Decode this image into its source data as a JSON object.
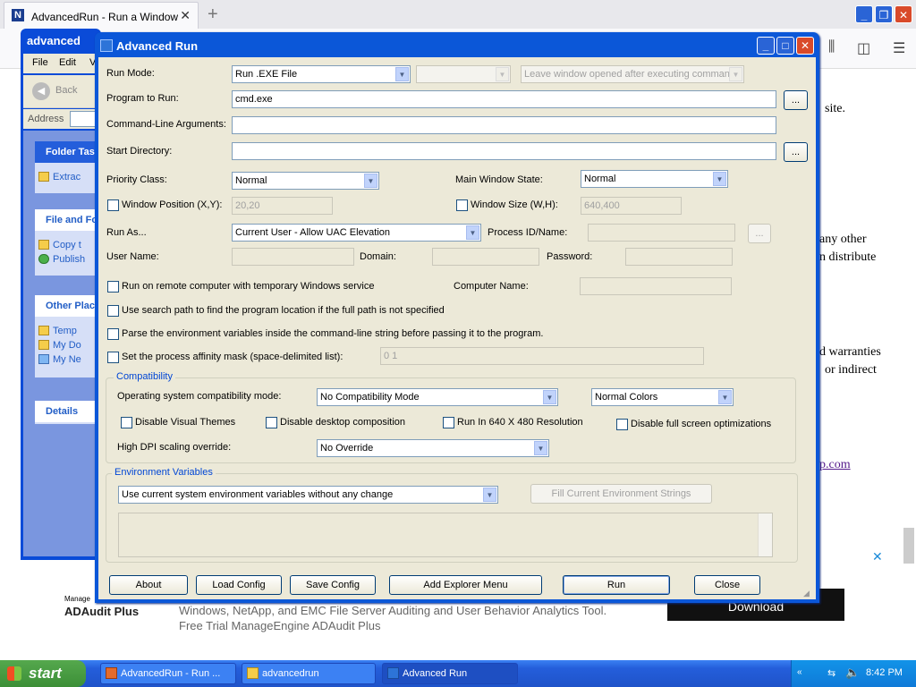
{
  "browser": {
    "tab_title": "AdvancedRun - Run a Windows p",
    "tab_close": "✕",
    "new_tab": "+",
    "favicon_letter": "N",
    "win_min": "_",
    "win_max": "❐",
    "win_close": "✕",
    "page_text": [
      "site.",
      "any other",
      "n distribute",
      "d warranties",
      "or indirect",
      "p.com"
    ],
    "ad_brand_small": "Manage",
    "ad_brand": "ADAudit Plus",
    "ad_line1": "Windows, NetApp, and EMC File Server Auditing and User Behavior Analytics Tool.",
    "ad_line2": "Free Trial ManageEngine ADAudit Plus",
    "ad_download": "Download",
    "ad_close": "✕"
  },
  "explorer": {
    "title": "advanced",
    "menu": [
      "File",
      "Edit",
      "V"
    ],
    "back": "Back",
    "address_label": "Address",
    "panels": [
      {
        "title": "Folder Tas",
        "items": [
          "Extrac"
        ]
      },
      {
        "title": "File and Fo",
        "items": [
          "Copy t",
          "Publish"
        ]
      },
      {
        "title": "Other Plac",
        "items": [
          "Temp",
          "My Do",
          "My Ne"
        ]
      },
      {
        "title": "Details",
        "items": []
      }
    ]
  },
  "dialog": {
    "title": "Advanced Run",
    "run_mode_label": "Run Mode:",
    "run_mode_value": "Run .EXE File",
    "run_mode_extra": "",
    "leave_window": "Leave window opened after executing comman",
    "program_label": "Program to Run:",
    "program_value": "cmd.exe",
    "browse": "...",
    "args_label": "Command-Line Arguments:",
    "args_value": "",
    "startdir_label": "Start Directory:",
    "startdir_value": "",
    "priority_label": "Priority Class:",
    "priority_value": "Normal",
    "mainwin_label": "Main Window State:",
    "mainwin_value": "Normal",
    "winpos_label": "Window Position (X,Y):",
    "winpos_value": "20,20",
    "winsize_label": "Window Size (W,H):",
    "winsize_value": "640,400",
    "runas_label": "Run As...",
    "runas_value": "Current User - Allow UAC Elevation",
    "pid_label": "Process ID/Name:",
    "pid_value": "",
    "username_label": "User Name:",
    "domain_label": "Domain:",
    "password_label": "Password:",
    "remote_label": "Run on remote computer with temporary Windows service",
    "computer_label": "Computer Name:",
    "search_path_label": "Use search path to find the program location if the full path is not specified",
    "parse_env_label": "Parse the environment variables inside the command-line string before passing it to the program.",
    "affinity_label": "Set the process affinity mask (space-delimited list):",
    "affinity_value": "0 1",
    "compat_group": "Compatibility",
    "compat_mode_label": "Operating system compatibility mode:",
    "compat_mode_value": "No Compatibility Mode",
    "colors_value": "Normal Colors",
    "disable_themes": "Disable Visual Themes",
    "disable_desktop": "Disable desktop composition",
    "run640": "Run In 640 X 480 Resolution",
    "disable_fullscreen": "Disable full screen optimizations",
    "dpi_label": "High DPI scaling override:",
    "dpi_value": "No Override",
    "env_group": "Environment Variables",
    "env_value": "Use current system environment variables without any change",
    "fill_env": "Fill Current Environment Strings",
    "buttons": {
      "about": "About",
      "load": "Load Config",
      "save": "Save Config",
      "explorer_menu": "Add Explorer Menu",
      "run": "Run",
      "close": "Close"
    }
  },
  "taskbar": {
    "start": "start",
    "tasks": [
      "AdvancedRun - Run ...",
      "advancedrun",
      "Advanced Run"
    ],
    "clock": "8:42 PM"
  }
}
